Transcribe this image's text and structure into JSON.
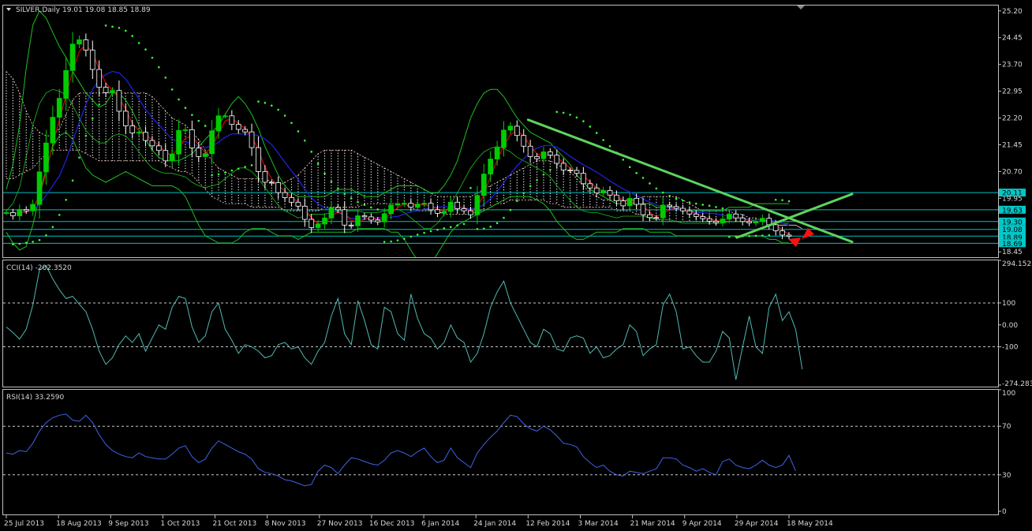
{
  "main_header": "SILVER,Daily  19.01 19.08 18.85 18.89",
  "cci_header": "CCI(14) -202.3520",
  "rsi_header": "RSI(14) 33.2590",
  "x_labels": [
    "25 Jul 2013",
    "18 Aug 2013",
    "9 Sep 2013",
    "1 Oct 2013",
    "21 Oct 2013",
    "8 Nov 2013",
    "27 Nov 2013",
    "16 Dec 2013",
    "6 Jan 2014",
    "24 Jan 2014",
    "12 Feb 2014",
    "3 Mar 2014",
    "21 Mar 2014",
    "9 Apr 2014",
    "29 Apr 2014",
    "18 May 2014"
  ],
  "colors": {
    "up_candle": "#00cc00",
    "down_candle": "#ffffff",
    "bb": "#1fbf1f",
    "sar": "#39ff39",
    "ma_red": "#e00000",
    "ma_blue": "#2323e6",
    "cloud": "#ffffff",
    "cloud_alt": "#ffd7c8",
    "hline": "#00bfbf",
    "trendline": "#5fd35f",
    "arrow": "#ff1010",
    "cci": "#4fb9b2",
    "rsi": "#3f63e8",
    "badge_bg": "#00c8c8",
    "frame": "#c0c0c0"
  },
  "chart_data": [
    {
      "type": "candlestick",
      "panel": "main",
      "symbol": "SILVER",
      "timeframe": "Daily",
      "ohlc_last": {
        "open": 19.01,
        "high": 19.08,
        "low": 18.85,
        "close": 18.89
      },
      "y_ticks": [
        25.2,
        24.45,
        23.7,
        22.95,
        22.2,
        21.45,
        20.7,
        19.95,
        18.45
      ],
      "ylim": [
        18.3,
        25.35
      ],
      "price_badges": [
        20.11,
        19.63,
        19.3,
        19.08,
        18.89,
        18.69
      ],
      "closes": [
        19.55,
        19.46,
        19.64,
        19.6,
        19.78,
        20.69,
        21.5,
        22.22,
        22.75,
        23.53,
        24.27,
        24.39,
        24.1,
        23.56,
        23.06,
        22.91,
        22.97,
        22.39,
        21.98,
        21.78,
        21.8,
        21.57,
        21.42,
        21.29,
        21.0,
        21.19,
        21.85,
        21.87,
        21.36,
        21.12,
        21.2,
        21.84,
        22.26,
        22.26,
        22.02,
        21.88,
        21.81,
        21.37,
        20.7,
        20.4,
        20.39,
        20.11,
        19.97,
        19.84,
        19.73,
        19.36,
        19.13,
        19.23,
        19.4,
        19.69,
        19.63,
        19.2,
        19.18,
        19.46,
        19.43,
        19.34,
        19.29,
        19.52,
        19.76,
        19.79,
        19.81,
        19.7,
        19.79,
        19.81,
        19.63,
        19.53,
        19.58,
        19.84,
        19.66,
        19.6,
        19.49,
        20.03,
        20.63,
        21.05,
        21.37,
        21.86,
        21.97,
        21.71,
        21.41,
        21.12,
        21.06,
        21.25,
        21.16,
        20.93,
        20.74,
        20.73,
        20.65,
        20.36,
        20.24,
        20.1,
        20.17,
        20.04,
        19.88,
        19.74,
        19.95,
        19.78,
        19.49,
        19.41,
        19.4,
        19.76,
        19.72,
        19.67,
        19.6,
        19.51,
        19.44,
        19.38,
        19.31,
        19.27,
        19.37,
        19.51,
        19.4,
        19.3,
        19.26,
        19.3,
        19.39,
        19.21,
        19.04,
        18.92,
        18.89
      ],
      "bb_upper": [
        20.2,
        20.9,
        22.0,
        23.6,
        24.8,
        25.2,
        25.0,
        24.6,
        24.2,
        23.9,
        23.5,
        23.2,
        22.9,
        22.7,
        22.5,
        22.6,
        22.9,
        22.9,
        22.7,
        22.4,
        22.0,
        21.6,
        21.3,
        21.1,
        21.0,
        21.0,
        21.0,
        21.1,
        21.2,
        21.4,
        21.6,
        21.8,
        22.0,
        22.3,
        22.6,
        22.8,
        22.6,
        22.3,
        21.9,
        21.4,
        21.0,
        20.6,
        20.3,
        20.1,
        20.0,
        20.0,
        20.0,
        20.0,
        20.0,
        20.1,
        20.2,
        20.2,
        20.2,
        20.1,
        20.0,
        20.0,
        20.0,
        20.1,
        20.2,
        20.3,
        20.3,
        20.3,
        20.3,
        20.2,
        20.1,
        20.1,
        20.3,
        20.6,
        21.0,
        21.6,
        22.2,
        22.6,
        22.9,
        23.0,
        23.0,
        22.8,
        22.5,
        22.2,
        22.0,
        21.8,
        21.7,
        21.6,
        21.5,
        21.3,
        21.1,
        20.9,
        20.6,
        20.4,
        20.2,
        20.1,
        20.0,
        19.9,
        19.8,
        19.8,
        19.8,
        19.8,
        19.8,
        19.8,
        19.7,
        19.7,
        19.7,
        19.7,
        19.6,
        19.6,
        19.6,
        19.6,
        19.6,
        19.6,
        19.6,
        19.7,
        19.7,
        19.7,
        19.7,
        19.8,
        19.8,
        19.8,
        19.8,
        19.8,
        19.8
      ],
      "bb_lower": [
        19.0,
        18.7,
        18.5,
        18.6,
        19.2,
        20.0,
        20.8,
        21.4,
        21.7,
        21.8,
        21.6,
        21.2,
        20.8,
        20.6,
        20.5,
        20.4,
        20.5,
        20.6,
        20.7,
        20.6,
        20.5,
        20.4,
        20.3,
        20.3,
        20.3,
        20.3,
        20.2,
        20.0,
        19.6,
        19.2,
        18.9,
        18.8,
        18.7,
        18.7,
        18.7,
        18.8,
        19.0,
        19.1,
        19.1,
        19.1,
        19.0,
        18.9,
        18.9,
        18.9,
        18.8,
        18.9,
        19.0,
        19.0,
        19.0,
        19.0,
        19.0,
        19.0,
        19.0,
        19.1,
        19.1,
        19.1,
        19.1,
        19.1,
        19.0,
        19.0,
        18.8,
        18.5,
        18.2,
        18.0,
        18.1,
        18.4,
        18.7,
        19.0,
        19.2,
        19.3,
        19.4,
        19.5,
        19.6,
        19.7,
        19.8,
        19.9,
        20.0,
        20.0,
        20.0,
        20.0,
        19.9,
        19.8,
        19.6,
        19.3,
        19.1,
        18.9,
        18.8,
        18.8,
        18.9,
        19.0,
        19.0,
        19.0,
        19.0,
        19.1,
        19.1,
        19.1,
        19.1,
        19.0,
        19.0,
        19.0,
        19.0,
        18.9,
        18.9,
        18.9,
        18.9,
        18.9,
        18.9,
        18.9,
        18.9,
        18.9,
        18.9,
        18.9,
        18.9,
        18.9,
        18.9,
        18.8,
        18.8,
        18.7,
        18.7
      ],
      "cloud_top": [
        23.5,
        23.3,
        22.9,
        22.4,
        22.0,
        21.8,
        21.7,
        21.7,
        21.9,
        22.3,
        22.7,
        22.9,
        22.9,
        22.9,
        22.9,
        22.9,
        22.9,
        22.9,
        22.9,
        22.9,
        22.9,
        22.9,
        22.8,
        22.6,
        22.4,
        22.2,
        22.1,
        22.0,
        21.8,
        21.6,
        21.3,
        21.0,
        20.8,
        20.7,
        20.6,
        20.5,
        20.5,
        20.5,
        20.5,
        20.5,
        20.4,
        20.3,
        20.4,
        20.5,
        20.6,
        20.8,
        21.0,
        21.2,
        21.3,
        21.3,
        21.3,
        21.3,
        21.3,
        21.2,
        21.1,
        21.0,
        20.9,
        20.8,
        20.7,
        20.6,
        20.5,
        20.4,
        20.3,
        20.2,
        20.1,
        20.0,
        20.0,
        20.0,
        20.0,
        20.0,
        20.0,
        20.1,
        20.2,
        20.3,
        20.4,
        20.5,
        20.6,
        20.7,
        20.8,
        20.9,
        21.0,
        21.0,
        21.0,
        20.9,
        20.8,
        20.7,
        20.5,
        20.3,
        20.1,
        20.0,
        19.9,
        19.9,
        19.9,
        19.9,
        19.9,
        19.9,
        20.0,
        20.0,
        20.0,
        20.0,
        20.0,
        20.0,
        19.9,
        19.8,
        19.7,
        19.6,
        19.6,
        19.6,
        19.6,
        19.6,
        19.5,
        19.5,
        19.4,
        19.4,
        19.3,
        19.3,
        19.2,
        19.2,
        19.2,
        19.2,
        19.1
      ],
      "cloud_bottom": [
        20.5,
        20.5,
        20.6,
        20.7,
        20.8,
        21.0,
        21.2,
        21.3,
        21.3,
        21.3,
        21.3,
        21.3,
        21.2,
        21.1,
        21.0,
        21.0,
        21.0,
        21.0,
        21.0,
        21.0,
        21.0,
        21.0,
        21.0,
        21.0,
        20.9,
        20.8,
        20.7,
        20.7,
        20.6,
        20.4,
        20.2,
        20.0,
        19.9,
        19.8,
        19.8,
        19.8,
        19.8,
        19.7,
        19.7,
        19.7,
        19.7,
        19.7,
        19.6,
        19.6,
        19.6,
        19.6,
        19.6,
        19.6,
        19.7,
        19.7,
        19.7,
        19.7,
        19.7,
        19.7,
        19.8,
        19.8,
        19.8,
        19.8,
        19.8,
        19.8,
        19.8,
        19.7,
        19.6,
        19.6,
        19.6,
        19.6,
        19.5,
        19.5,
        19.5,
        19.5,
        19.5,
        19.6,
        19.6,
        19.7,
        19.8,
        19.8,
        19.9,
        19.9,
        19.9,
        19.9,
        19.9,
        19.9,
        19.8,
        19.8,
        19.7,
        19.7,
        19.7,
        19.7,
        19.7,
        19.7,
        19.7,
        19.7,
        19.6,
        19.6,
        19.6,
        19.5,
        19.5,
        19.4,
        19.4,
        19.3,
        19.3,
        19.3,
        19.3,
        19.3,
        19.3,
        19.3,
        19.3,
        19.3,
        19.3,
        19.3,
        19.3,
        19.3,
        19.3,
        19.3,
        19.3,
        19.3,
        19.2,
        19.2,
        19.2,
        19.2,
        19.1
      ],
      "trendlines": [
        {
          "from": [
            "12 Feb 2014",
            22.15
          ],
          "to": [
            "18 May 2014",
            18.85
          ]
        },
        {
          "from": [
            "29 Apr 2014",
            18.85
          ],
          "to": [
            "18 May 2014",
            19.95
          ]
        }
      ],
      "arrows": [
        {
          "at": "18 May 2014",
          "direction": "down"
        },
        {
          "at": "18 May 2014",
          "direction": "up"
        }
      ]
    },
    {
      "type": "line",
      "panel": "cci",
      "name": "CCI(14)",
      "last": -202.352,
      "y_ticks": [
        294.1526,
        100,
        0.0,
        -100,
        -274.283
      ],
      "y_tick_labels": [
        "294.1526",
        "100",
        "0.00",
        "-100",
        "-274.283"
      ],
      "ylim": [
        -274.283,
        294.1526
      ],
      "levels": [
        100,
        -100
      ],
      "values": [
        -10,
        -35,
        -65,
        -20,
        90,
        250,
        270,
        210,
        160,
        120,
        130,
        95,
        60,
        -20,
        -120,
        -180,
        -150,
        -90,
        -50,
        -80,
        -40,
        -120,
        -60,
        0,
        -20,
        80,
        130,
        120,
        -10,
        -80,
        -50,
        60,
        100,
        -20,
        -70,
        -130,
        -90,
        -100,
        -120,
        -150,
        -140,
        -90,
        -80,
        -110,
        -100,
        -150,
        -180,
        -120,
        -80,
        40,
        120,
        -40,
        -90,
        110,
        20,
        -90,
        -110,
        80,
        60,
        -40,
        -70,
        140,
        30,
        -40,
        -60,
        -110,
        -80,
        0,
        -60,
        -80,
        -170,
        -130,
        -40,
        80,
        150,
        200,
        100,
        40,
        -20,
        -80,
        -100,
        -20,
        -40,
        -110,
        -120,
        -60,
        -50,
        -60,
        -130,
        -100,
        -150,
        -140,
        -110,
        -90,
        0,
        -30,
        -140,
        -110,
        -90,
        90,
        140,
        60,
        -110,
        -100,
        -140,
        -170,
        -170,
        -120,
        -30,
        -60,
        -250,
        -100,
        40,
        -100,
        -130,
        80,
        140,
        20,
        60,
        -20,
        -202.35
      ]
    },
    {
      "type": "line",
      "panel": "rsi",
      "name": "RSI(14)",
      "last": 33.259,
      "y_ticks": [
        100,
        70,
        30,
        0
      ],
      "ylim": [
        0,
        100
      ],
      "levels": [
        70,
        30
      ],
      "values": [
        48,
        47,
        50,
        49,
        56,
        66,
        73,
        77,
        79,
        80,
        75,
        74,
        79,
        73,
        63,
        55,
        50,
        47,
        45,
        44,
        48,
        45,
        44,
        43,
        43,
        47,
        52,
        54,
        45,
        40,
        43,
        52,
        58,
        55,
        52,
        49,
        47,
        43,
        35,
        32,
        31,
        29,
        26,
        25,
        23,
        21,
        22,
        33,
        38,
        36,
        31,
        38,
        44,
        43,
        41,
        39,
        38,
        42,
        48,
        50,
        48,
        45,
        49,
        52,
        45,
        40,
        42,
        52,
        44,
        40,
        36,
        48,
        55,
        61,
        66,
        73,
        79,
        78,
        72,
        68,
        66,
        70,
        67,
        62,
        56,
        55,
        53,
        45,
        40,
        36,
        38,
        33,
        30,
        29,
        33,
        32,
        31,
        33,
        35,
        44,
        44,
        43,
        38,
        36,
        33,
        35,
        32,
        30,
        41,
        43,
        38,
        36,
        35,
        38,
        42,
        38,
        36,
        38,
        46,
        33.259
      ]
    }
  ]
}
